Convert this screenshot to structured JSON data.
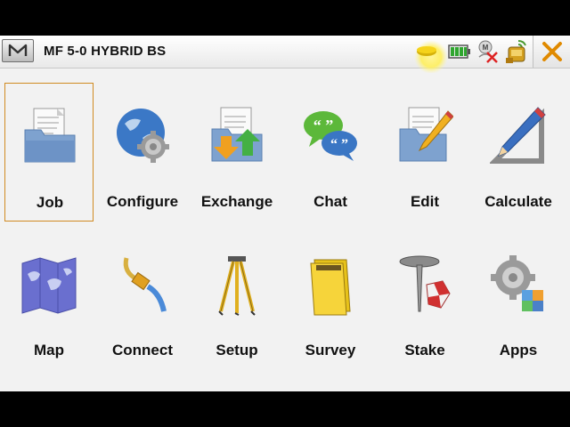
{
  "titlebar": {
    "menu_label": "M",
    "title": "MF 5-0 HYBRID BS",
    "status_icons": [
      "satellite-status-icon",
      "battery-icon",
      "radio-disconnected-icon",
      "receiver-icon"
    ],
    "close_icon": "close-icon"
  },
  "tiles": [
    {
      "label": "Job",
      "icon": "job-folder-icon",
      "selected": true
    },
    {
      "label": "Configure",
      "icon": "configure-globe-gear-icon"
    },
    {
      "label": "Exchange",
      "icon": "exchange-folder-icon"
    },
    {
      "label": "Chat",
      "icon": "chat-bubbles-icon"
    },
    {
      "label": "Edit",
      "icon": "edit-folder-pencil-icon"
    },
    {
      "label": "Calculate",
      "icon": "calculate-pencil-ruler-icon"
    },
    {
      "label": "Map",
      "icon": "map-icon"
    },
    {
      "label": "Connect",
      "icon": "connect-cable-icon"
    },
    {
      "label": "Setup",
      "icon": "tripod-icon"
    },
    {
      "label": "Survey",
      "icon": "survey-notebook-icon"
    },
    {
      "label": "Stake",
      "icon": "stake-pin-icon"
    },
    {
      "label": "Apps",
      "icon": "apps-gear-icon"
    }
  ],
  "colors": {
    "selection_border": "#d08a22",
    "background": "#f2f2f2",
    "close_x": "#e08a00"
  }
}
